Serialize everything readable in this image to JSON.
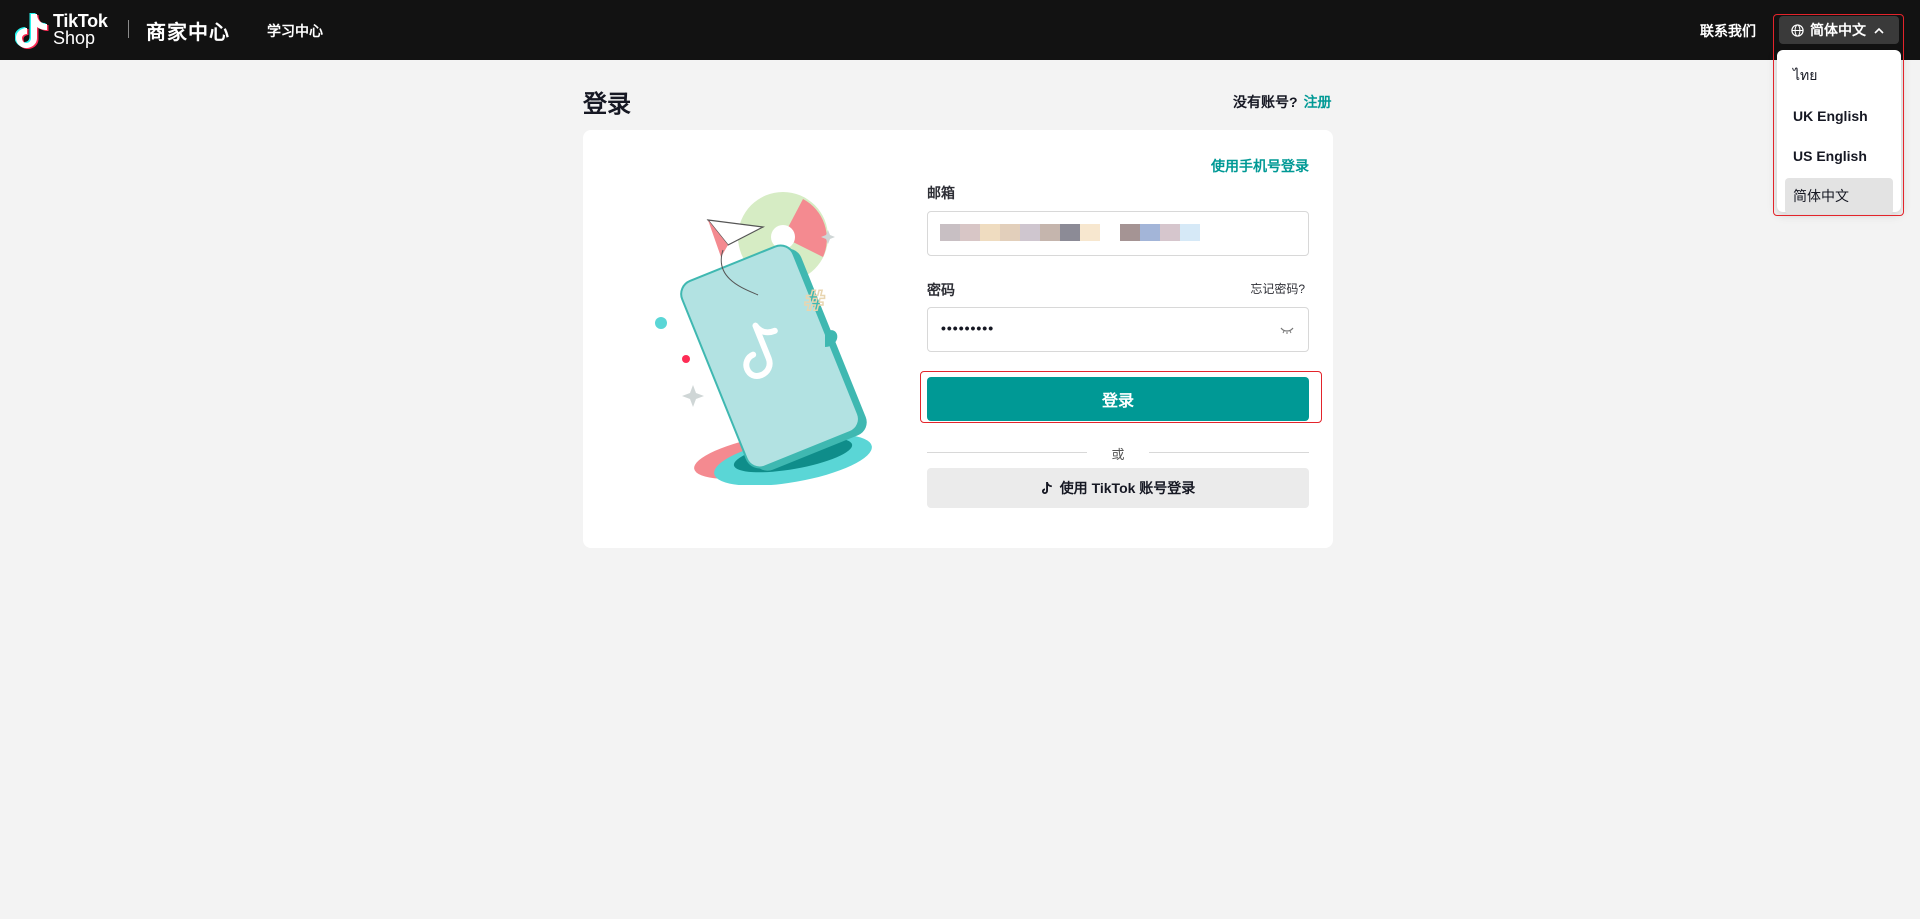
{
  "header": {
    "logo_line1": "TikTok",
    "logo_line2": "Shop",
    "brand_title": "商家中心",
    "learning_center": "学习中心",
    "contact_us": "联系我们",
    "language_button": "简体中文"
  },
  "language_menu": {
    "items": [
      "ไทย",
      "UK English",
      "US English",
      "简体中文"
    ],
    "selected": "简体中文"
  },
  "page": {
    "title": "登录",
    "no_account_text": "没有账号?",
    "signup_link": "注册"
  },
  "login_form": {
    "phone_login_link": "使用手机号登录",
    "email_label": "邮箱",
    "password_label": "密码",
    "forgot_password": "忘记密码?",
    "password_value": "•••••••••",
    "login_button": "登录",
    "or_text": "或",
    "tiktok_login_button": "使用 TikTok 账号登录"
  },
  "colors": {
    "accent": "#009995",
    "header_bg": "#121212",
    "highlight_box": "#e3242b"
  }
}
